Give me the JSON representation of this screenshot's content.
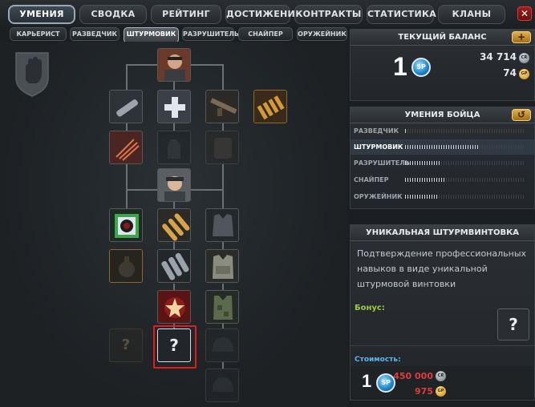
{
  "nav": {
    "tabs": [
      {
        "label": "УМЕНИЯ",
        "active": true
      },
      {
        "label": "СВОДКА",
        "active": false
      },
      {
        "label": "РЕЙТИНГ",
        "active": false
      },
      {
        "label": "ДОСТИЖЕНИЯ",
        "active": false
      },
      {
        "label": "КОНТРАКТЫ",
        "active": false
      },
      {
        "label": "СТАТИСТИКА",
        "active": false
      },
      {
        "label": "КЛАНЫ",
        "active": false
      }
    ],
    "close_glyph": "✕"
  },
  "classes": [
    {
      "label": "КАРЬЕРИСТ",
      "active": false
    },
    {
      "label": "РАЗВЕДЧИК",
      "active": false
    },
    {
      "label": "ШТУРМОВИК",
      "active": true
    },
    {
      "label": "РАЗРУШИТЕЛЬ",
      "active": false
    },
    {
      "label": "СНАЙПЕР",
      "active": false
    },
    {
      "label": "ОРУЖЕЙНИК",
      "active": false
    }
  ],
  "tree": {
    "emblem_icon": "fist-shield-icon",
    "nodes": [
      {
        "name": "soldier-portrait",
        "icon": "soldier-portrait-icon"
      },
      {
        "name": "silencer",
        "icon": "silencer-icon"
      },
      {
        "name": "medkit-plus",
        "icon": "plus-icon"
      },
      {
        "name": "assault-rifle",
        "icon": "rifle-icon"
      },
      {
        "name": "ammo-belt",
        "icon": "ammo-icon"
      },
      {
        "name": "scratch",
        "icon": "scratch-icon"
      },
      {
        "name": "locked-glove",
        "icon": "glove-icon"
      },
      {
        "name": "locked-armor",
        "icon": "armor-icon"
      },
      {
        "name": "soldier-portrait-2",
        "icon": "soldier-portrait-icon"
      },
      {
        "name": "green-target",
        "icon": "target-icon"
      },
      {
        "name": "bullets",
        "icon": "bullets-icon"
      },
      {
        "name": "vest",
        "icon": "vest-icon"
      },
      {
        "name": "grenade",
        "icon": "grenade-icon"
      },
      {
        "name": "shotgun-shells",
        "icon": "shells-icon"
      },
      {
        "name": "heavy-vest",
        "icon": "heavy-vest-icon"
      },
      {
        "name": "star-badge",
        "icon": "star-icon"
      },
      {
        "name": "camo-vest",
        "icon": "camo-vest-icon"
      },
      {
        "name": "unknown-1",
        "icon": "question-icon"
      },
      {
        "name": "unknown-selected",
        "icon": "question-icon"
      },
      {
        "name": "locked-helmet",
        "icon": "helmet-icon"
      },
      {
        "name": "locked-helmet-2",
        "icon": "helmet-icon"
      }
    ]
  },
  "balance": {
    "title": "ТЕКУЩИЙ БАЛАНС",
    "sp_value": "1",
    "sp_label": "SP",
    "credits": "34 714",
    "credits_label": "CR",
    "gold": "74",
    "gold_label": "GP",
    "add_glyph": "+"
  },
  "skills": {
    "title": "УМЕНИЯ БОЙЦА",
    "reset_glyph": "↺",
    "rows": [
      {
        "label": "РАЗВЕДЧИК",
        "progress": 0.01,
        "active": false
      },
      {
        "label": "ШТУРМОВИК",
        "progress": 0.62,
        "active": true
      },
      {
        "label": "РАЗРУШИТЕЛЬ",
        "progress": 0.3,
        "active": false
      },
      {
        "label": "СНАЙПЕР",
        "progress": 0.33,
        "active": false
      },
      {
        "label": "ОРУЖЕЙНИК",
        "progress": 0.27,
        "active": false
      }
    ]
  },
  "detail": {
    "title": "УНИКАЛЬНАЯ ШТУРМВИНТОВКА",
    "description": "Подтверждение профессиональных навыков в виде уникальной штурмовой винтовки",
    "bonus_label": "Бонус:",
    "cost_label": "Стоимость:",
    "cost_sp": "1",
    "cost_sp_label": "SP",
    "cost_credits": "450 000",
    "cost_credits_label": "CR",
    "cost_gold": "975",
    "cost_gold_label": "GP"
  },
  "colors": {
    "accent_gold": "#e0b04b",
    "price_red": "#e03b3b",
    "bonus_green": "#9bcb3e",
    "cost_blue": "#58b6e8",
    "selection_red": "#e21c1c"
  }
}
